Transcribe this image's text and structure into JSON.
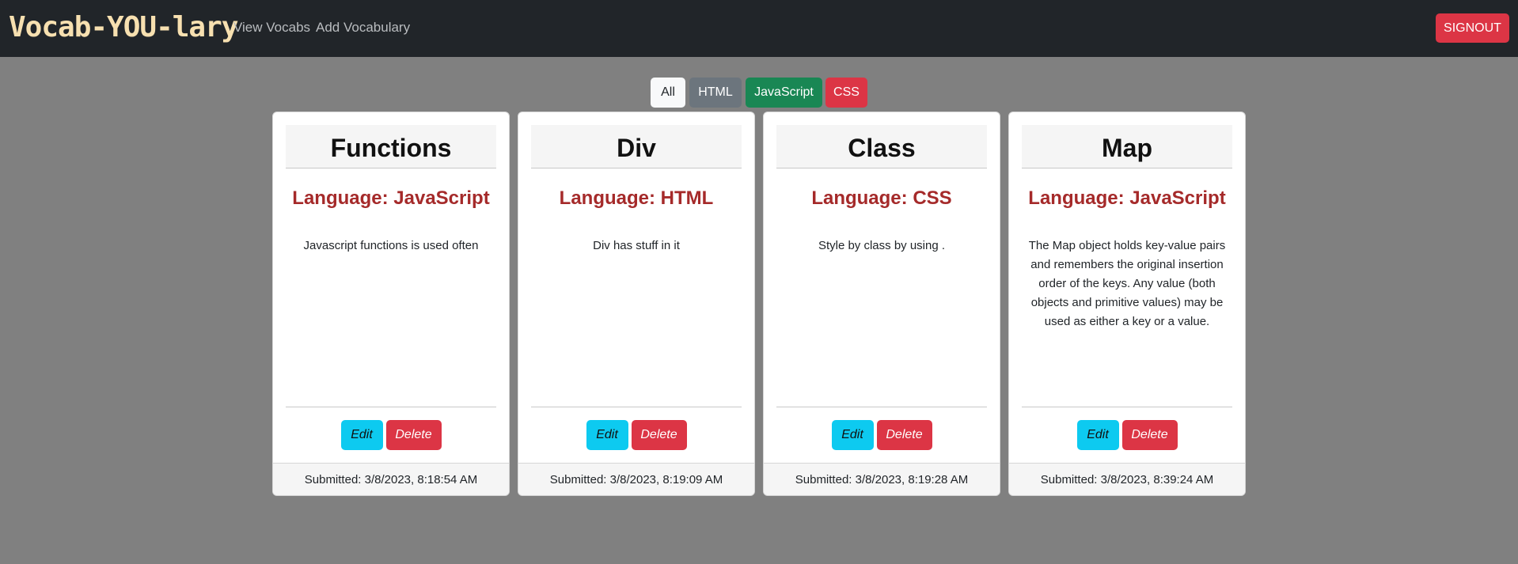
{
  "navbar": {
    "brand": "Vocab-YOU-lary",
    "links": [
      "View Vocabs",
      "Add Vocabulary"
    ],
    "signout_label": "SIGNOUT"
  },
  "filters": {
    "all": "All",
    "html": "HTML",
    "javascript": "JavaScript",
    "css": "CSS"
  },
  "cards": [
    {
      "title": "Functions",
      "language": "Language: JavaScript",
      "definition": "Javascript functions is used often",
      "edit_label": "Edit",
      "delete_label": "Delete",
      "submitted": "Submitted: 3/8/2023, 8:18:54 AM"
    },
    {
      "title": "Div",
      "language": "Language: HTML",
      "definition": "Div has stuff in it",
      "edit_label": "Edit",
      "delete_label": "Delete",
      "submitted": "Submitted: 3/8/2023, 8:19:09 AM"
    },
    {
      "title": "Class",
      "language": "Language: CSS",
      "definition": "Style by class by using .",
      "edit_label": "Edit",
      "delete_label": "Delete",
      "submitted": "Submitted: 3/8/2023, 8:19:28 AM"
    },
    {
      "title": "Map",
      "language": "Language: JavaScript",
      "definition": "The Map object holds key-value pairs and remembers the original insertion order of the keys. Any value (both objects and primitive values) may be used as either a key or a value.",
      "edit_label": "Edit",
      "delete_label": "Delete",
      "submitted": "Submitted: 3/8/2023, 8:39:24 AM"
    }
  ],
  "colors": {
    "navbar_bg": "#212529",
    "page_bg": "#808080",
    "brand": "#f7e0b0",
    "language_text": "#a52a2a",
    "danger": "#dc3545",
    "success": "#198754",
    "info": "#0dcaf0",
    "secondary": "#6c757d"
  }
}
